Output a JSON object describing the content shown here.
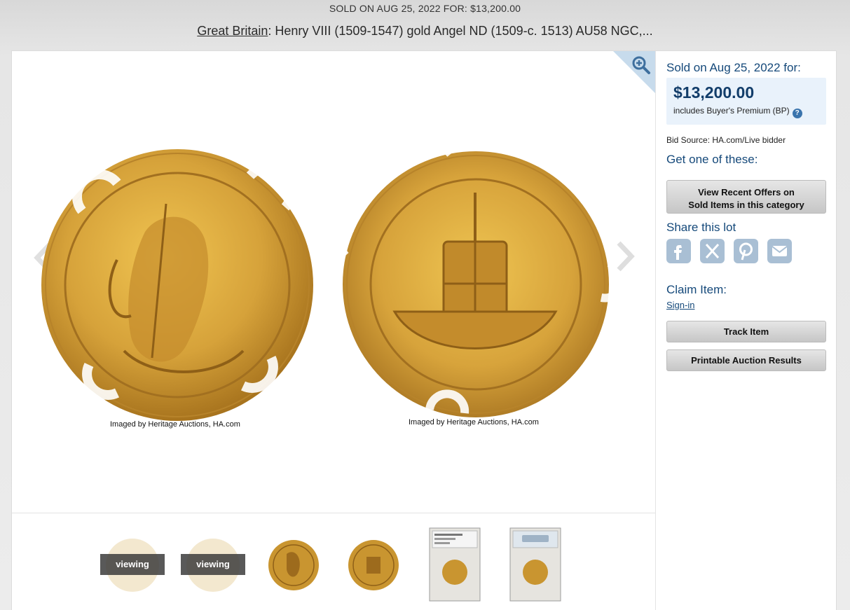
{
  "banner": {
    "text": "SOLD ON AUG 25, 2022 FOR: $13,200.00"
  },
  "title": {
    "link_text": "Great Britain",
    "rest": ": Henry VIII (1509-1547) gold Angel ND (1509-c. 1513) AU58 NGC,..."
  },
  "viewer": {
    "captions": [
      "Imaged by Heritage Auctions, HA.com",
      "Imaged by Heritage Auctions, HA.com"
    ],
    "icons": {
      "zoom": "zoom-in-icon",
      "prev": "chevron-left-icon",
      "next": "chevron-right-icon"
    }
  },
  "thumbnails": [
    {
      "badge": "viewing"
    },
    {
      "badge": "viewing"
    },
    {
      "badge": ""
    },
    {
      "badge": ""
    },
    {
      "badge": ""
    },
    {
      "badge": ""
    }
  ],
  "sidebar": {
    "sold_label": "Sold on Aug 25, 2022 for:",
    "price": "$13,200.00",
    "price_note": "includes Buyer's Premium (BP)",
    "help": "?",
    "bid_source": "Bid Source: HA.com/Live bidder",
    "get_one": "Get one of these:",
    "offers_line1": "View Recent Offers on",
    "offers_line2": "Sold Items in this category",
    "share_label": "Share this lot",
    "share_icons": [
      "facebook-icon",
      "x-icon",
      "pinterest-icon",
      "email-icon"
    ],
    "claim_label": "Claim Item:",
    "sign_in": "Sign-in",
    "track": "Track Item",
    "print": "Printable Auction Results"
  },
  "colors": {
    "link_blue": "#15497a",
    "price_bg": "#e9f2fb",
    "share_icon": "#a9bfd4",
    "gold": "#c9962f"
  }
}
